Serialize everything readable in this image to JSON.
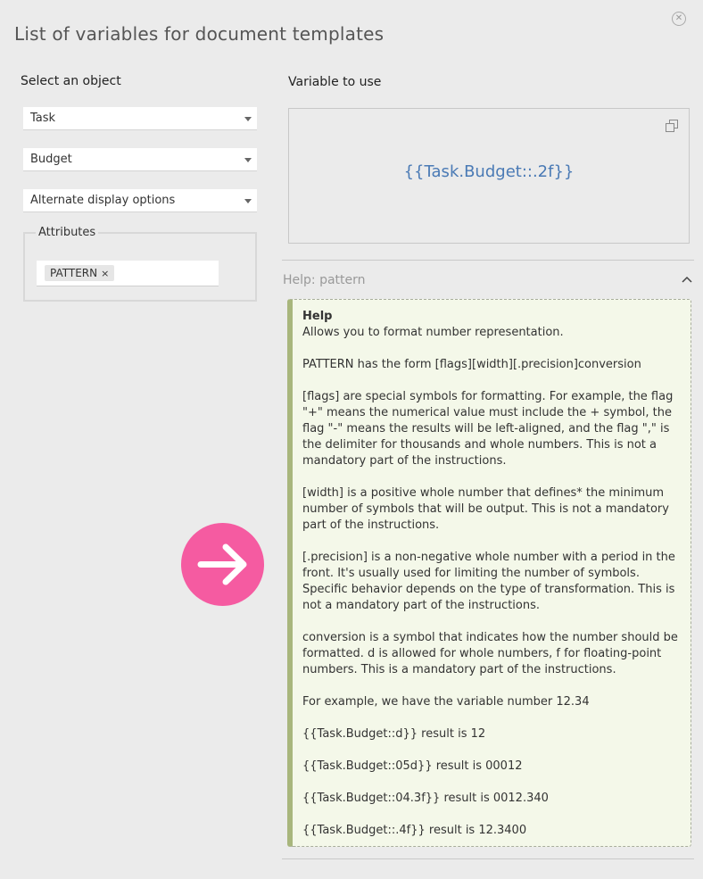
{
  "dialog": {
    "title": "List of variables for document templates",
    "close_icon": "close-circle-icon"
  },
  "left": {
    "label": "Select an object",
    "selects": [
      "Task",
      "Budget",
      "Alternate display options"
    ],
    "attributes": {
      "legend": "Attributes",
      "tags": [
        {
          "label": "PATTERN",
          "remove": "×"
        }
      ]
    }
  },
  "right": {
    "label": "Variable to use",
    "variable": "{{Task.Budget::.2f}}",
    "copy_icon": "copy-icon",
    "help_header": "Help: pattern",
    "help": {
      "title": "Help",
      "paragraphs": [
        "Allows you to format number representation.",
        "PATTERN has the form [flags][width][.precision]conversion",
        "[flags] are special symbols for formatting. For example, the flag \"+\" means the numerical value must include the + symbol, the flag \"-\" means the results will be left-aligned, and the flag \",\" is the delimiter for thousands and whole numbers. This is not a mandatory part of the instructions.",
        "[width] is a positive whole number that defines* the minimum number of symbols that will be output. This is not a mandatory part of the instructions.",
        "[.precision] is a non-negative whole number with a period in the front. It's usually used for limiting the number of symbols. Specific behavior depends on the type of transformation. This is not a mandatory part of the instructions.",
        "conversion is a symbol that indicates how the number should be formatted. d is allowed for whole numbers, f for floating-point numbers. This is a mandatory part of the instructions.",
        "For example, we have the variable number 12.34",
        "{{Task.Budget::d}} result is 12",
        "{{Task.Budget::05d}} result is 00012",
        "{{Task.Budget::04.3f}} result is 0012.340",
        "{{Task.Budget::.4f}} result is 12.3400"
      ]
    }
  },
  "overlay": {
    "icon": "arrow-right-icon",
    "color": "#f55ba1"
  }
}
